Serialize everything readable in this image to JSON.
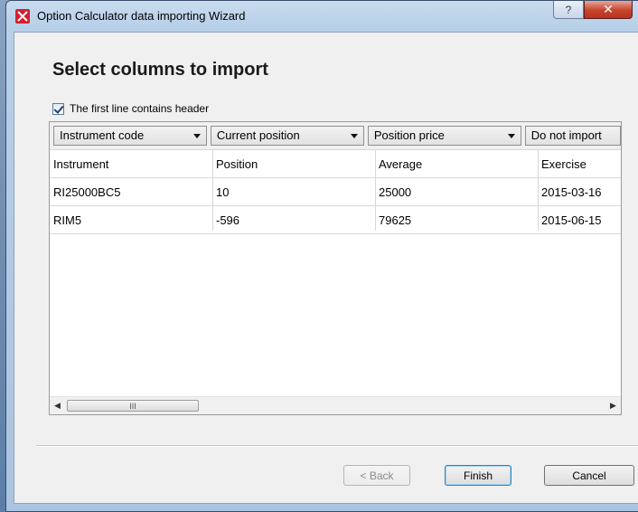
{
  "window": {
    "title": "Option Calculator data importing Wizard",
    "help_glyph": "?",
    "close_glyph": "✕"
  },
  "page": {
    "heading": "Select columns to import",
    "header_checkbox_label": "The first line contains header",
    "header_checkbox_checked": true
  },
  "columns": [
    {
      "mapping": "Instrument code"
    },
    {
      "mapping": "Current position"
    },
    {
      "mapping": "Position price"
    },
    {
      "mapping": "Do not import"
    }
  ],
  "rows": [
    [
      "Instrument",
      "Position",
      "Average",
      "Exercise"
    ],
    [
      "RI25000BC5",
      "10",
      "25000",
      "2015-03-16"
    ],
    [
      "RIM5",
      "-596",
      "79625",
      "2015-06-15"
    ]
  ],
  "scrollbar": {
    "left_glyph": "◀",
    "right_glyph": "▶",
    "thumb_grip": "III"
  },
  "buttons": {
    "back": "< Back",
    "finish": "Finish",
    "cancel": "Cancel"
  },
  "colors": {
    "accent": "#3c7fb1",
    "app_icon": "#d3202f",
    "close": "#c7432b"
  }
}
